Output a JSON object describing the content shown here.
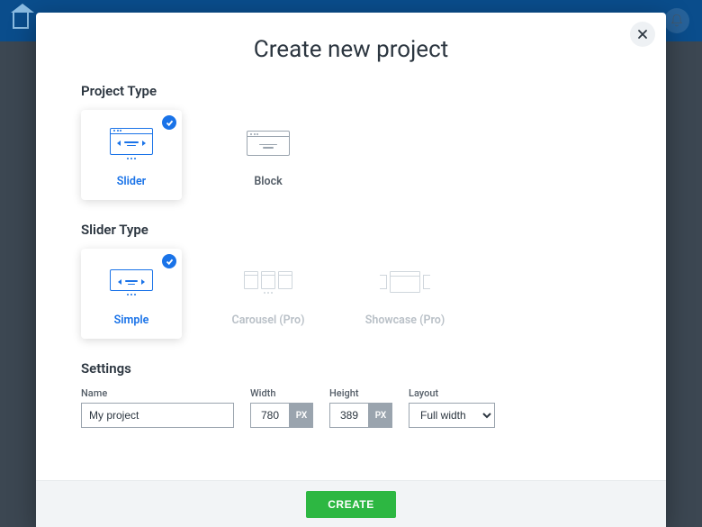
{
  "topbar": {
    "home_icon": "home-icon",
    "bell_icon": "bell-icon"
  },
  "modal": {
    "title": "Create new project",
    "close_icon": "close-icon",
    "sections": {
      "project_type": {
        "heading": "Project Type",
        "options": [
          {
            "label": "Slider",
            "selected": true
          },
          {
            "label": "Block",
            "selected": false
          }
        ]
      },
      "slider_type": {
        "heading": "Slider Type",
        "options": [
          {
            "label": "Simple",
            "selected": true,
            "disabled": false
          },
          {
            "label": "Carousel (Pro)",
            "selected": false,
            "disabled": true
          },
          {
            "label": "Showcase (Pro)",
            "selected": false,
            "disabled": true
          }
        ]
      },
      "settings": {
        "heading": "Settings",
        "name": {
          "label": "Name",
          "value": "My project"
        },
        "width": {
          "label": "Width",
          "value": "780",
          "unit": "PX"
        },
        "height": {
          "label": "Height",
          "value": "389",
          "unit": "PX"
        },
        "layout": {
          "label": "Layout",
          "value": "Full width"
        }
      }
    },
    "footer": {
      "create_label": "CREATE"
    }
  },
  "colors": {
    "accent": "#1a73e8",
    "success": "#2db742",
    "topbar": "#0a4d8c"
  }
}
